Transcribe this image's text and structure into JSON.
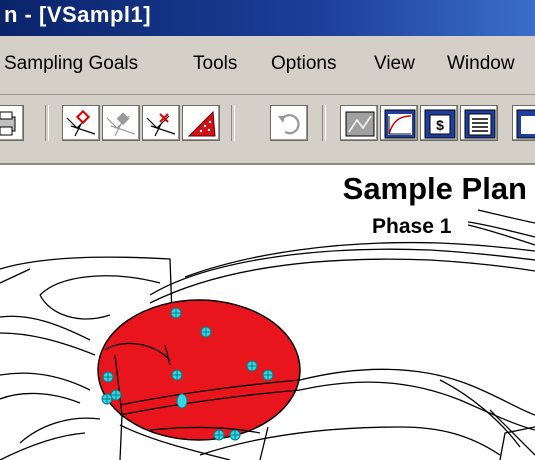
{
  "window": {
    "title": "n - [VSampl1]"
  },
  "menubar": {
    "items": [
      {
        "name": "menu-sampling-goals",
        "label": "Sampling Goals"
      },
      {
        "name": "menu-tools",
        "label": "Tools"
      },
      {
        "name": "menu-options",
        "label": "Options"
      },
      {
        "name": "menu-view",
        "label": "View"
      },
      {
        "name": "menu-window",
        "label": "Window"
      }
    ]
  },
  "toolbar": {
    "buttons": [
      "print-icon",
      "add-sample-point-icon",
      "move-sample-point-icon",
      "delete-sample-point-icon",
      "sample-area-fill-icon",
      "undo-icon",
      "map-view-icon",
      "graph-view-icon",
      "cost-view-icon",
      "report-view-icon"
    ]
  },
  "plan": {
    "title": "Sample Plan",
    "phase": "Phase 1"
  },
  "colors": {
    "sample_area": "#e8161c",
    "sample_point": "#34d7e6",
    "title_bar": "#0a246a",
    "chrome": "#d4d0c8"
  }
}
